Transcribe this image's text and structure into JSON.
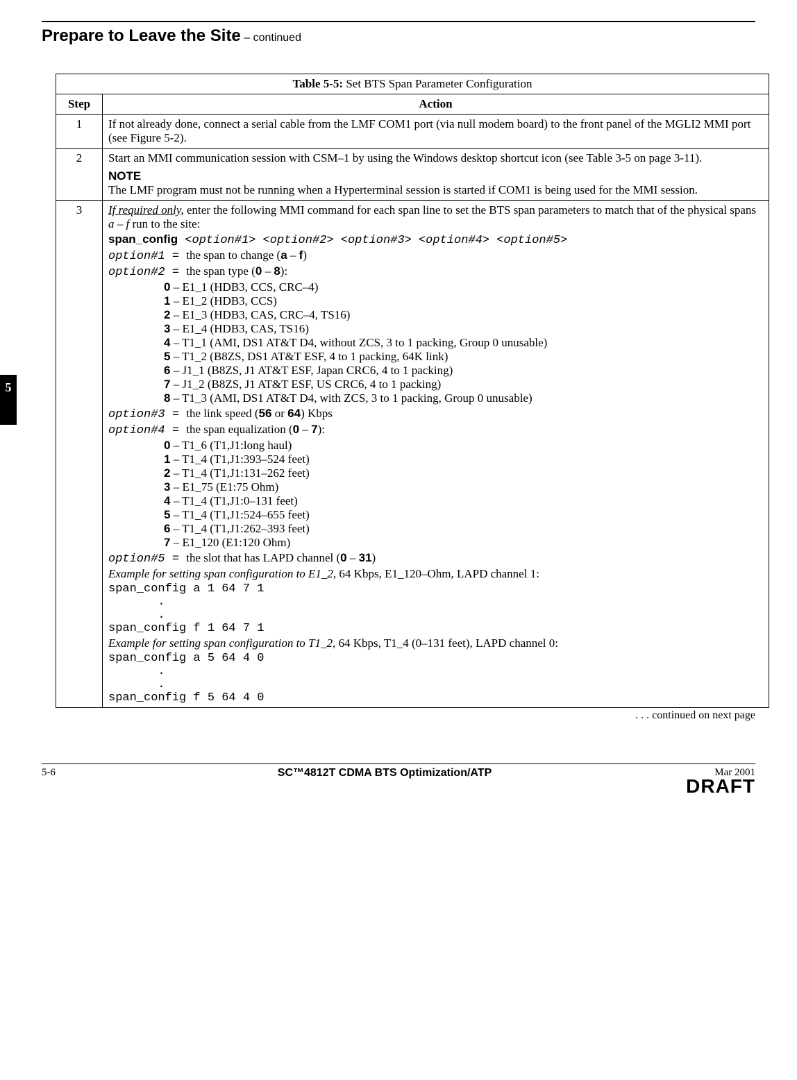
{
  "header": {
    "title": "Prepare to Leave the Site",
    "continued": "  – continued"
  },
  "sideTab": "5",
  "table": {
    "caption_bold": "Table 5-5:",
    "caption_rest": " Set BTS Span Parameter Configuration",
    "col_step": "Step",
    "col_action": "Action",
    "rows": {
      "r1": {
        "step": "1",
        "text": "If not already done, connect a serial cable from the LMF COM1 port (via null modem board) to the front panel of the MGLI2 MMI port (see Figure 5-2)."
      },
      "r2": {
        "step": "2",
        "line1": "Start an MMI communication session with CSM–1 by using the Windows desktop shortcut icon (see Table 3-5 on page 3-11).",
        "note_hd": "NOTE",
        "note_body": "The LMF program must not be running when a Hyperterminal session is started if COM1 is being used for the MMI session."
      },
      "r3": {
        "step": "3",
        "intro_u": "If required only,",
        "intro_rest_a": " enter the following MMI command for each span line to set the BTS span parameters to match that of the physical spans ",
        "intro_span": "a – f",
        "intro_rest_b": " run to the site:",
        "cmd_name": "span_config",
        "cmd_args": "  <option#1> <option#2> <option#3> <option#4> <option#5>",
        "opt1_lhs": "option#1",
        "opt1_eq": "  = ",
        "opt1_txt": " the span to change (",
        "opt1_a": "a",
        "opt1_dash": " – ",
        "opt1_f": "f",
        "opt1_close": ")",
        "opt2_lhs": "option#2",
        "opt2_eq": "  = ",
        "opt2_txt": " the span type (",
        "opt2_lo": "0",
        "opt2_dash": " – ",
        "opt2_hi": "8",
        "opt2_close": "):",
        "opt2_items": [
          {
            "b": "0",
            "t": " – E1_1 (HDB3, CCS, CRC–4)"
          },
          {
            "b": "1",
            "t": " – E1_2 (HDB3, CCS)"
          },
          {
            "b": "2",
            "t": " – E1_3 (HDB3, CAS, CRC–4, TS16)"
          },
          {
            "b": "3",
            "t": " – E1_4 (HDB3, CAS, TS16)"
          },
          {
            "b": "4",
            "t": " – T1_1 (AMI, DS1 AT&T D4, without ZCS, 3 to 1 packing, Group 0 unusable)"
          },
          {
            "b": "5",
            "t": " – T1_2 (B8ZS, DS1 AT&T ESF, 4 to 1 packing, 64K link)"
          },
          {
            "b": "6",
            "t": " – J1_1 (B8ZS, J1 AT&T ESF, Japan CRC6, 4 to 1 packing)"
          },
          {
            "b": "7",
            "t": " – J1_2 (B8ZS, J1 AT&T ESF, US CRC6, 4 to 1 packing)"
          },
          {
            "b": "8",
            "t": " – T1_3 (AMI, DS1 AT&T D4, with ZCS, 3 to 1 packing, Group 0 unusable)"
          }
        ],
        "opt3_lhs": "option#3",
        "opt3_eq": "  = ",
        "opt3_txt_a": " the link speed (",
        "opt3_56": "56",
        "opt3_or": " or ",
        "opt3_64": "64",
        "opt3_txt_b": ") Kbps",
        "opt4_lhs": "option#4",
        "opt4_eq": "  = ",
        "opt4_txt": " the span equalization (",
        "opt4_lo": "0",
        "opt4_dash": " – ",
        "opt4_hi": "7",
        "opt4_close": "):",
        "opt4_items": [
          {
            "b": "0",
            "t": " – T1_6 (T1,J1:long haul)"
          },
          {
            "b": "1",
            "t": " – T1_4 (T1,J1:393–524 feet)"
          },
          {
            "b": "2",
            "t": " – T1_4 (T1,J1:131–262 feet)"
          },
          {
            "b": "3",
            "t": " – E1_75 (E1:75 Ohm)"
          },
          {
            "b": "4",
            "t": " – T1_4 (T1,J1:0–131 feet)"
          },
          {
            "b": "5",
            "t": " – T1_4 (T1,J1:524–655 feet)"
          },
          {
            "b": "6",
            "t": " – T1_4 (T1,J1:262–393 feet)"
          },
          {
            "b": "7",
            "t": " – E1_120 (E1:120 Ohm)"
          }
        ],
        "opt5_lhs": "option#5",
        "opt5_eq": "  = ",
        "opt5_txt_a": " the slot that has LAPD channel (",
        "opt5_lo": "0",
        "opt5_dash": " – ",
        "opt5_hi": "31",
        "opt5_txt_b": ")",
        "ex1_i": "Example for setting span configuration to E1_2",
        "ex1_rest": ", 64 Kbps, E1_120–Ohm, LAPD channel 1:",
        "ex1_lines": [
          "span_config a 1 64 7 1",
          "       .",
          "       .",
          "span_config f 1 64 7 1"
        ],
        "ex2_i": "Example for setting span configuration to T1_2",
        "ex2_rest": ", 64 Kbps, T1_4 (0–131 feet), LAPD channel 0:",
        "ex2_lines": [
          "span_config a 5 64 4 0",
          "       .",
          "       .",
          "span_config f 5 64 4 0"
        ]
      }
    }
  },
  "continued_note": " . . . continued on next page",
  "footer": {
    "page": "5-6",
    "mid": "SC™4812T CDMA BTS Optimization/ATP",
    "date": "Mar 2001",
    "draft": "DRAFT"
  }
}
